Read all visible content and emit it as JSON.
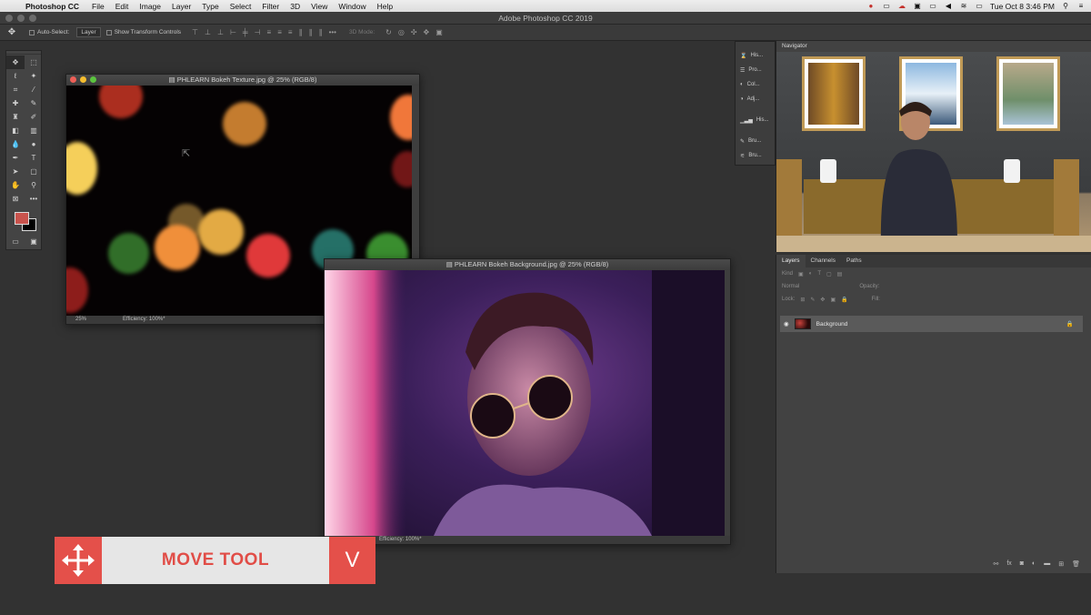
{
  "menubar": {
    "app_name": "Photoshop CC",
    "items": [
      "File",
      "Edit",
      "Image",
      "Layer",
      "Type",
      "Select",
      "Filter",
      "3D",
      "View",
      "Window",
      "Help"
    ],
    "clock": "Tue Oct 8  3:46 PM"
  },
  "app_title": "Adobe Photoshop CC 2019",
  "options": {
    "auto_select_label": "Auto-Select:",
    "auto_select_value": "Layer",
    "transform_label": "Show Transform Controls",
    "mode_3d": "3D Mode:"
  },
  "colors": {
    "foreground": "#c9534d",
    "background": "#000000",
    "accent": "#e4504a"
  },
  "doc_bokeh": {
    "title": "PHLEARN Bokeh Texture.jpg @ 25% (RGB/8)",
    "zoom": "25%",
    "efficiency": "Efficiency: 100%*"
  },
  "doc_portrait": {
    "title": "PHLEARN Bokeh Background.jpg @ 25% (RGB/8)",
    "efficiency": "Efficiency: 100%*"
  },
  "mini_panels": {
    "items": [
      "His...",
      "Pro...",
      "Col...",
      "Adj...",
      "His...",
      "Bru...",
      "Bru..."
    ]
  },
  "navigator": {
    "title": "Navigator"
  },
  "layers": {
    "tabs": [
      "Layers",
      "Channels",
      "Paths"
    ],
    "kind_label": "Kind",
    "blend_mode": "Normal",
    "opacity_label": "Opacity:",
    "lock_label": "Lock:",
    "fill_label": "Fill:",
    "layer_name": "Background"
  },
  "lower_third": {
    "label": "MOVE TOOL",
    "shortcut": "V",
    "icon": "move-arrows-icon"
  }
}
